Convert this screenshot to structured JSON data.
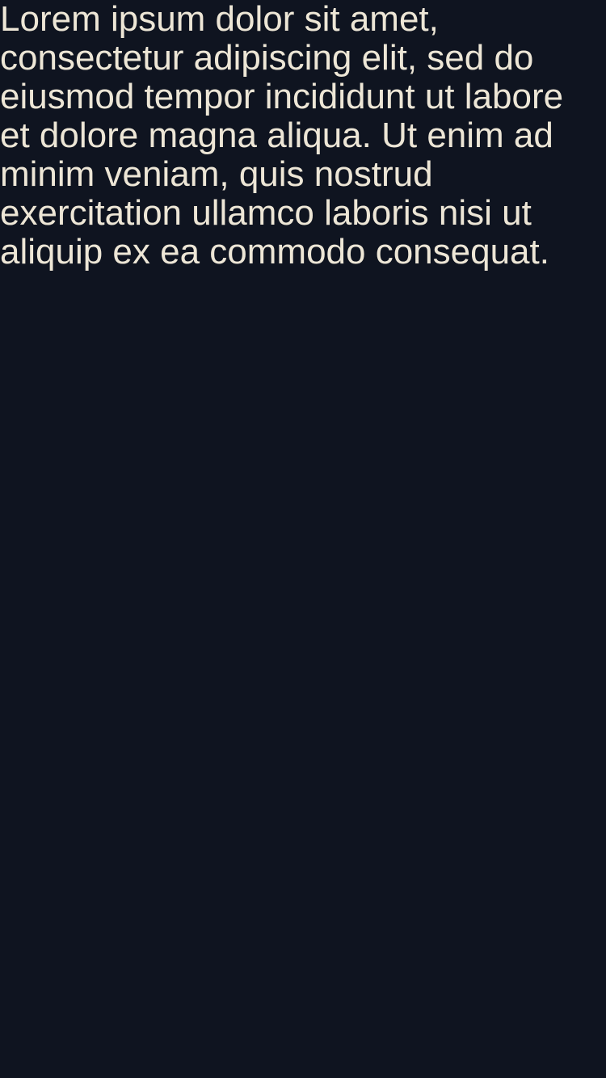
{
  "content": {
    "paragraph": "Lorem ipsum dolor sit amet, consectetur adipiscing elit, sed do eiusmod tempor incididunt ut labore et dolore magna aliqua. Ut enim ad minim veniam, quis nostrud exercitation ullamco laboris nisi ut aliquip ex ea commodo consequat."
  },
  "theme": {
    "background": "#0f1420",
    "text": "#ede6d6"
  }
}
